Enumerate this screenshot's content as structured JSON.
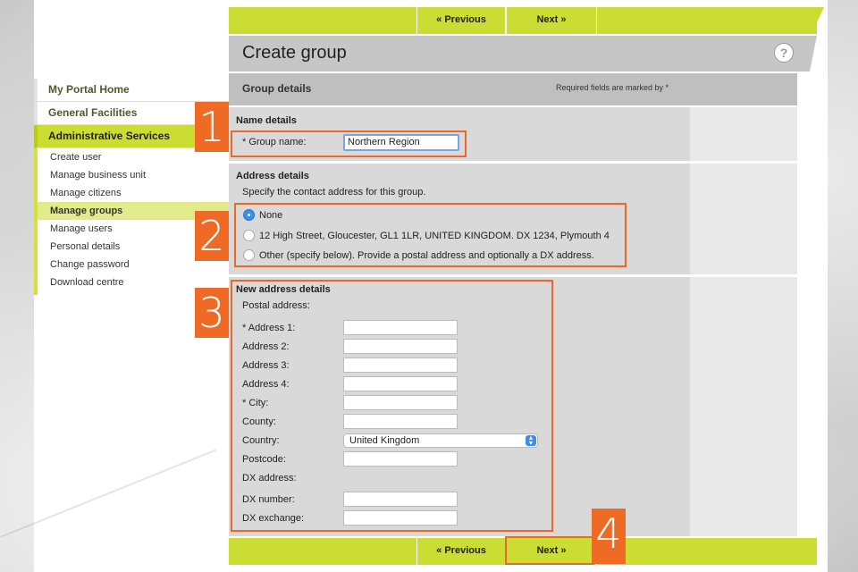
{
  "nav": {
    "prev_label": "« Previous",
    "next_label": "Next »"
  },
  "page": {
    "title": "Create group",
    "help_icon": "help-icon"
  },
  "group_details": {
    "title": "Group details",
    "required_note": "Required fields are marked by *"
  },
  "sidebar": {
    "headers": [
      "My Portal Home",
      "General Facilities",
      "Administrative Services"
    ],
    "active_header": "Administrative Services",
    "items": [
      "Create user",
      "Manage business unit",
      "Manage citizens",
      "Manage groups",
      "Manage users",
      "Personal details",
      "Change password",
      "Download centre"
    ],
    "current_item": "Manage groups"
  },
  "name_details": {
    "title": "Name details",
    "label": "* Group name:",
    "value": "Northern Region"
  },
  "address_details": {
    "title": "Address details",
    "description": "Specify the contact address for this group.",
    "options": [
      "None",
      "12 High Street, Gloucester, GL1 1LR, UNITED KINGDOM. DX 1234, Plymouth 4",
      "Other (specify below). Provide a postal address and optionally a DX address."
    ],
    "selected": "None"
  },
  "new_address": {
    "title": "New address details",
    "postal_label": "Postal address:",
    "fields": {
      "address1": "* Address 1:",
      "address2": "Address 2:",
      "address3": "Address 3:",
      "address4": "Address 4:",
      "city": "* City:",
      "county": "County:",
      "country": "Country:",
      "postcode": "Postcode:"
    },
    "country_value": "United Kingdom",
    "dx_label": "DX address:",
    "dx_number": "DX number:",
    "dx_exchange": "DX exchange:"
  },
  "annotations": [
    "1",
    "2",
    "3",
    "4"
  ],
  "colors": {
    "accent": "#cbdc32",
    "annotation": "#ee6a25",
    "panel": "#d9d9d9"
  }
}
